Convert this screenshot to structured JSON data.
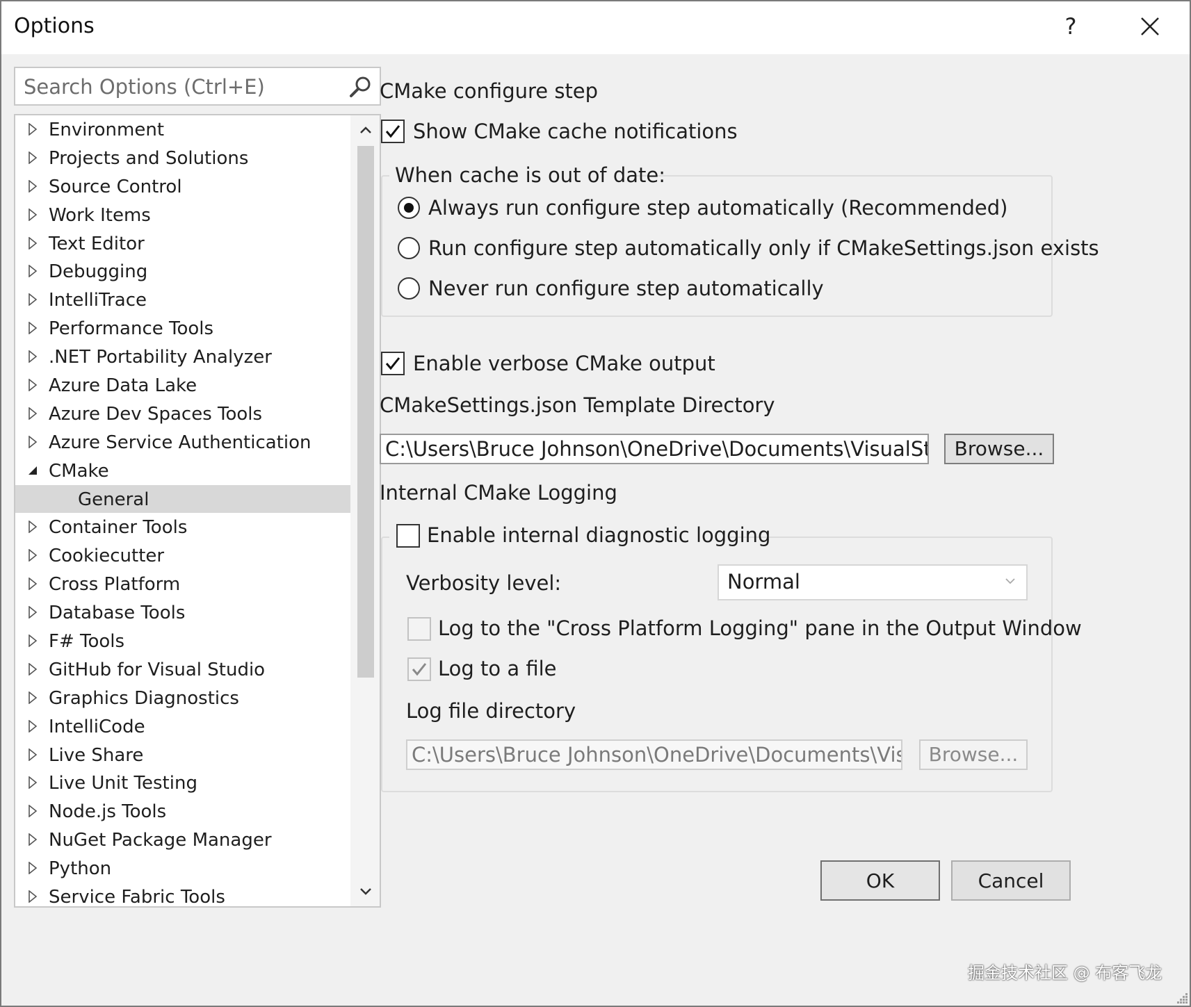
{
  "window": {
    "title": "Options",
    "help_label": "?"
  },
  "search": {
    "placeholder": "Search Options (Ctrl+E)"
  },
  "tree": {
    "items": [
      {
        "label": "Environment"
      },
      {
        "label": "Projects and Solutions"
      },
      {
        "label": "Source Control"
      },
      {
        "label": "Work Items"
      },
      {
        "label": "Text Editor"
      },
      {
        "label": "Debugging"
      },
      {
        "label": "IntelliTrace"
      },
      {
        "label": "Performance Tools"
      },
      {
        "label": ".NET Portability Analyzer"
      },
      {
        "label": "Azure Data Lake"
      },
      {
        "label": "Azure Dev Spaces Tools"
      },
      {
        "label": "Azure Service Authentication"
      },
      {
        "label": "CMake"
      },
      {
        "label": "General"
      },
      {
        "label": "Container Tools"
      },
      {
        "label": "Cookiecutter"
      },
      {
        "label": "Cross Platform"
      },
      {
        "label": "Database Tools"
      },
      {
        "label": "F# Tools"
      },
      {
        "label": "GitHub for Visual Studio"
      },
      {
        "label": "Graphics Diagnostics"
      },
      {
        "label": "IntelliCode"
      },
      {
        "label": "Live Share"
      },
      {
        "label": "Live Unit Testing"
      },
      {
        "label": "Node.js Tools"
      },
      {
        "label": "NuGet Package Manager"
      },
      {
        "label": "Python"
      },
      {
        "label": "Service Fabric Tools"
      }
    ],
    "expanded": "CMake",
    "selected": "General"
  },
  "configure": {
    "heading": "CMake configure step",
    "show_notifications_label": "Show CMake cache notifications",
    "show_notifications_checked": true,
    "group_label": "When cache is out of date:",
    "options": [
      "Always run configure step automatically (Recommended)",
      "Run configure step automatically only if CMakeSettings.json exists",
      "Never run configure step automatically"
    ],
    "selected_option": 0
  },
  "verbose": {
    "label": "Enable verbose CMake output",
    "checked": true
  },
  "template": {
    "heading": "CMakeSettings.json Template Directory",
    "path": "C:\\Users\\Bruce Johnson\\OneDrive\\Documents\\VisualStudio\\CMake",
    "browse_label": "Browse..."
  },
  "logging": {
    "heading": "Internal CMake Logging",
    "enable_label": "Enable internal diagnostic logging",
    "enable_checked": false,
    "verbosity_label": "Verbosity level:",
    "verbosity_value": "Normal",
    "pane_label": "Log to the \"Cross Platform Logging\" pane in the Output Window",
    "pane_checked": false,
    "file_label": "Log to a file",
    "file_checked": true,
    "dir_label": "Log file directory",
    "dir_path": "C:\\Users\\Bruce Johnson\\OneDrive\\Documents\\Visual Studio",
    "browse_label": "Browse..."
  },
  "footer": {
    "ok_label": "OK",
    "cancel_label": "Cancel"
  },
  "watermark": "掘金技术社区 @ 布客飞龙"
}
